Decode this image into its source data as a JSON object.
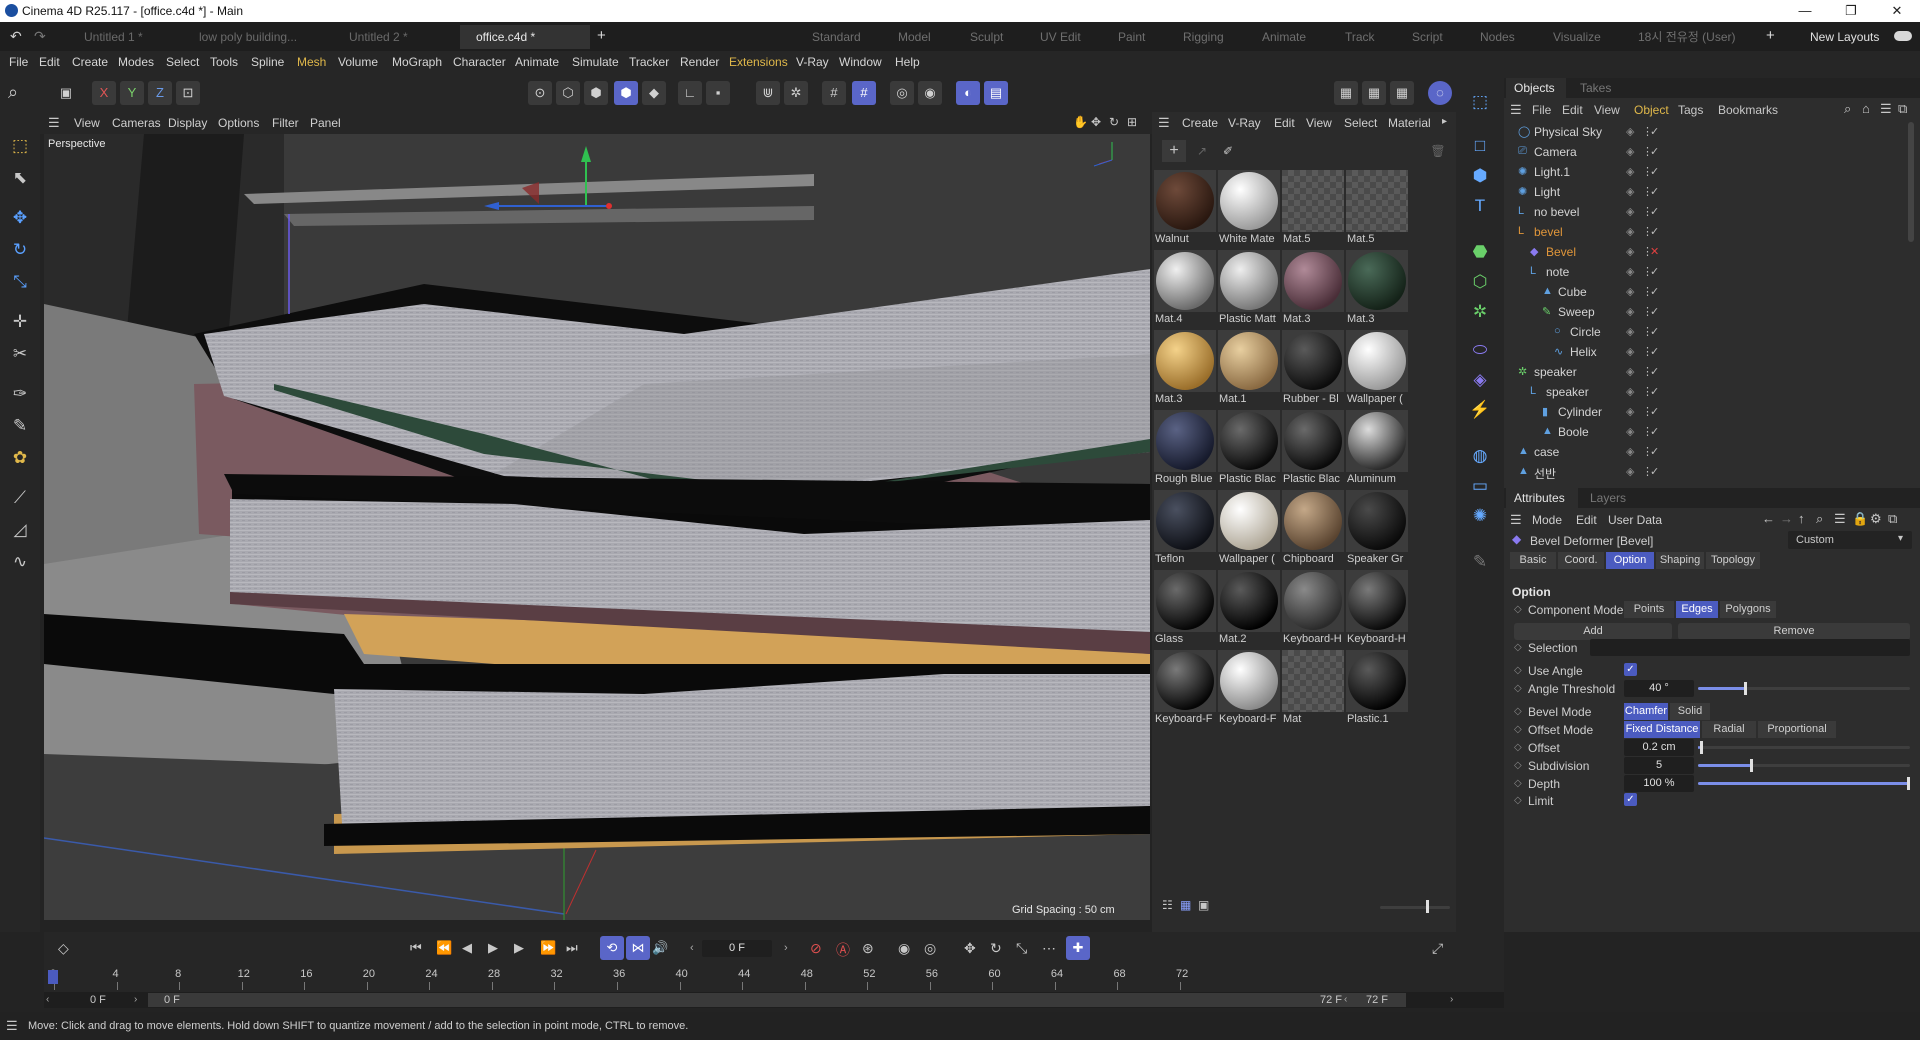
{
  "window": {
    "title": "Cinema 4D R25.117 - [office.c4d *] - Main",
    "minimize": "—",
    "maximize": "❐",
    "close": "✕"
  },
  "tabs": [
    {
      "label": "Untitled 1 *"
    },
    {
      "label": "low poly building..."
    },
    {
      "label": "Untitled 2 *"
    },
    {
      "label": "office.c4d *"
    }
  ],
  "add_tab": "+",
  "layouts": [
    "Standard",
    "Model",
    "Sculpt",
    "UV Edit",
    "Paint",
    "Rigging",
    "Animate",
    "Track",
    "Script",
    "Nodes",
    "Visualize",
    "18시 전유정 (User)"
  ],
  "new_layouts": "New Layouts",
  "menu": [
    "File",
    "Edit",
    "Create",
    "Modes",
    "Select",
    "Tools",
    "Spline",
    "Mesh",
    "Volume",
    "MoGraph",
    "Character",
    "Animate",
    "Simulate",
    "Tracker",
    "Render",
    "Extensions",
    "V-Ray",
    "Window",
    "Help"
  ],
  "menu_colors": {
    "Mesh": "#e0b84a",
    "Extensions": "#e0b84a"
  },
  "axis_buttons": [
    "X",
    "Y",
    "Z"
  ],
  "viewport": {
    "menu": [
      "View",
      "Cameras",
      "Display",
      "Options",
      "Filter",
      "Panel"
    ],
    "camera_label": "Perspective",
    "grid_spacing": "Grid Spacing : 50 cm"
  },
  "material_menu": [
    "Create",
    "V-Ray",
    "Edit",
    "View",
    "Select",
    "Material"
  ],
  "materials": [
    {
      "name": "Walnut",
      "c1": "#6e4a3a",
      "c2": "#2a1810"
    },
    {
      "name": "White Mate",
      "c1": "#ffffff",
      "c2": "#9a9a9a"
    },
    {
      "name": "Mat.5",
      "c1": "#5a5a5a",
      "c2": "#4a4a4a",
      "checker": true
    },
    {
      "name": "Mat.5",
      "c1": "#5a5a5a",
      "c2": "#4a4a4a",
      "checker": true
    },
    {
      "name": "Mat.4",
      "c1": "#f0f0f0",
      "c2": "#6a6a6a"
    },
    {
      "name": "Plastic Matt",
      "c1": "#eeeeee",
      "c2": "#777777"
    },
    {
      "name": "Mat.3",
      "c1": "#b08a98",
      "c2": "#4a2e38"
    },
    {
      "name": "Mat.3",
      "c1": "#4a6a58",
      "c2": "#142218"
    },
    {
      "name": "Mat.3",
      "c1": "#f4d28a",
      "c2": "#9a6e2a"
    },
    {
      "name": "Mat.1",
      "c1": "#e8cfa0",
      "c2": "#8a6a42"
    },
    {
      "name": "Rubber - Bl",
      "c1": "#5a5a5a",
      "c2": "#0c0c0c"
    },
    {
      "name": "Wallpaper (",
      "c1": "#ffffff",
      "c2": "#9a9a9a"
    },
    {
      "name": "Rough Blue",
      "c1": "#5a6284",
      "c2": "#161a2c"
    },
    {
      "name": "Plastic Blac",
      "c1": "#6a6a6a",
      "c2": "#0a0a0a"
    },
    {
      "name": "Plastic Blac",
      "c1": "#6a6a6a",
      "c2": "#0a0a0a"
    },
    {
      "name": "Aluminum",
      "c1": "#dcdcdc",
      "c2": "#2a2a2a"
    },
    {
      "name": "Teflon",
      "c1": "#4a5060",
      "c2": "#0e1016"
    },
    {
      "name": "Wallpaper (",
      "c1": "#ffffff",
      "c2": "#b0a898"
    },
    {
      "name": "Chipboard",
      "c1": "#c4a888",
      "c2": "#5a4430"
    },
    {
      "name": "Speaker Gr",
      "c1": "#4a4a4a",
      "c2": "#0a0a0a"
    },
    {
      "name": "Glass",
      "c1": "#6a6a6a",
      "c2": "#050505"
    },
    {
      "name": "Mat.2",
      "c1": "#5a5a5a",
      "c2": "#000000"
    },
    {
      "name": "Keyboard-H",
      "c1": "#8a8a8a",
      "c2": "#2a2a2a"
    },
    {
      "name": "Keyboard-H",
      "c1": "#7a7a7a",
      "c2": "#0a0a0a"
    },
    {
      "name": "Keyboard-F",
      "c1": "#7a7a7a",
      "c2": "#050505"
    },
    {
      "name": "Keyboard-F",
      "c1": "#ffffff",
      "c2": "#8a8a8a"
    },
    {
      "name": "Mat",
      "c1": "#5a5a5a",
      "c2": "#4a4a4a",
      "checker": true
    },
    {
      "name": "Plastic.1",
      "c1": "#5a5a5a",
      "c2": "#020202"
    }
  ],
  "objects_panel": {
    "tabs": [
      "Objects",
      "Takes"
    ],
    "menu": [
      "File",
      "Edit",
      "View",
      "Object",
      "Tags",
      "Bookmarks"
    ]
  },
  "objects": [
    {
      "name": "Physical Sky",
      "indent": 0,
      "icon": "sky-icon",
      "color": "#5fa0e0",
      "glyph": "◯"
    },
    {
      "name": "Camera",
      "indent": 0,
      "icon": "camera-icon",
      "color": "#5fa0e0",
      "glyph": "⎚"
    },
    {
      "name": "Light.1",
      "indent": 0,
      "icon": "light-icon",
      "color": "#5fa0e0",
      "glyph": "✺"
    },
    {
      "name": "Light",
      "indent": 0,
      "icon": "light-icon",
      "color": "#5fa0e0",
      "glyph": "✺"
    },
    {
      "name": "no bevel",
      "indent": 0,
      "icon": "null-icon",
      "color": "#5fa0e0",
      "glyph": "L"
    },
    {
      "name": "bevel",
      "indent": 0,
      "icon": "null-icon",
      "color": "#e0963a",
      "glyph": "L",
      "namecolor": "#e0963a"
    },
    {
      "name": "Bevel",
      "indent": 1,
      "icon": "bevel-deformer-icon",
      "color": "#8a7af0",
      "glyph": "◆",
      "namecolor": "#e0963a"
    },
    {
      "name": "note",
      "indent": 1,
      "icon": "null-icon",
      "color": "#5fa0e0",
      "glyph": "L"
    },
    {
      "name": "Cube",
      "indent": 2,
      "icon": "cube-icon",
      "color": "#5fa0e0",
      "glyph": "▲"
    },
    {
      "name": "Sweep",
      "indent": 2,
      "icon": "sweep-icon",
      "color": "#6ad06a",
      "glyph": "✎"
    },
    {
      "name": "Circle",
      "indent": 3,
      "icon": "circle-icon",
      "color": "#5fa0e0",
      "glyph": "○"
    },
    {
      "name": "Helix",
      "indent": 3,
      "icon": "helix-icon",
      "color": "#5fa0e0",
      "glyph": "∿"
    },
    {
      "name": "speaker",
      "indent": 0,
      "icon": "cloner-icon",
      "color": "#6ad06a",
      "glyph": "✲"
    },
    {
      "name": "speaker",
      "indent": 1,
      "icon": "null-icon",
      "color": "#5fa0e0",
      "glyph": "L"
    },
    {
      "name": "Cylinder",
      "indent": 2,
      "icon": "cylinder-icon",
      "color": "#5fa0e0",
      "glyph": "▮"
    },
    {
      "name": "Boole",
      "indent": 2,
      "icon": "boole-icon",
      "color": "#5fa0e0",
      "glyph": "▲"
    },
    {
      "name": "case",
      "indent": 0,
      "icon": "polygon-icon",
      "color": "#5fa0e0",
      "glyph": "▲"
    },
    {
      "name": "선반",
      "indent": 0,
      "icon": "polygon-icon",
      "color": "#5fa0e0",
      "glyph": "▲"
    }
  ],
  "attributes": {
    "tabs": [
      "Attributes",
      "Layers"
    ],
    "menu": [
      "Mode",
      "Edit",
      "User Data"
    ],
    "object": "Bevel Deformer [Bevel]",
    "preset": "Custom",
    "subtabs": [
      "Basic",
      "Coord.",
      "Option",
      "Shaping",
      "Topology"
    ],
    "section": "Option",
    "component_mode": {
      "label": "Component Mode",
      "options": [
        "Points",
        "Edges",
        "Polygons"
      ],
      "selected": "Edges"
    },
    "add": "Add",
    "remove": "Remove",
    "selection": {
      "label": "Selection",
      "value": ""
    },
    "use_angle": {
      "label": "Use Angle",
      "checked": true
    },
    "angle_threshold": {
      "label": "Angle Threshold",
      "value": "40 °",
      "fraction": 0.22
    },
    "bevel_mode": {
      "label": "Bevel Mode",
      "options": [
        "Chamfer",
        "Solid"
      ],
      "selected": "Chamfer"
    },
    "offset_mode": {
      "label": "Offset Mode",
      "options": [
        "Fixed Distance",
        "Radial",
        "Proportional"
      ],
      "selected": "Fixed Distance"
    },
    "offset": {
      "label": "Offset",
      "value": "0.2 cm",
      "fraction": 0.01
    },
    "subdivision": {
      "label": "Subdivision",
      "value": "5",
      "fraction": 0.25
    },
    "depth": {
      "label": "Depth",
      "value": "100 %",
      "fraction": 1.0
    },
    "limit": {
      "label": "Limit",
      "checked": true
    }
  },
  "timeline": {
    "current_frame": "0 F",
    "ticks": [
      "0",
      "4",
      "8",
      "12",
      "16",
      "20",
      "24",
      "28",
      "32",
      "36",
      "40",
      "44",
      "48",
      "52",
      "56",
      "60",
      "64",
      "68",
      "72"
    ],
    "start": "0 F",
    "start2": "0 F",
    "end": "72 F",
    "end2": "72 F"
  },
  "status": "Move: Click and drag to move elements. Hold down SHIFT to quantize movement / add to the selection in point mode, CTRL to remove."
}
